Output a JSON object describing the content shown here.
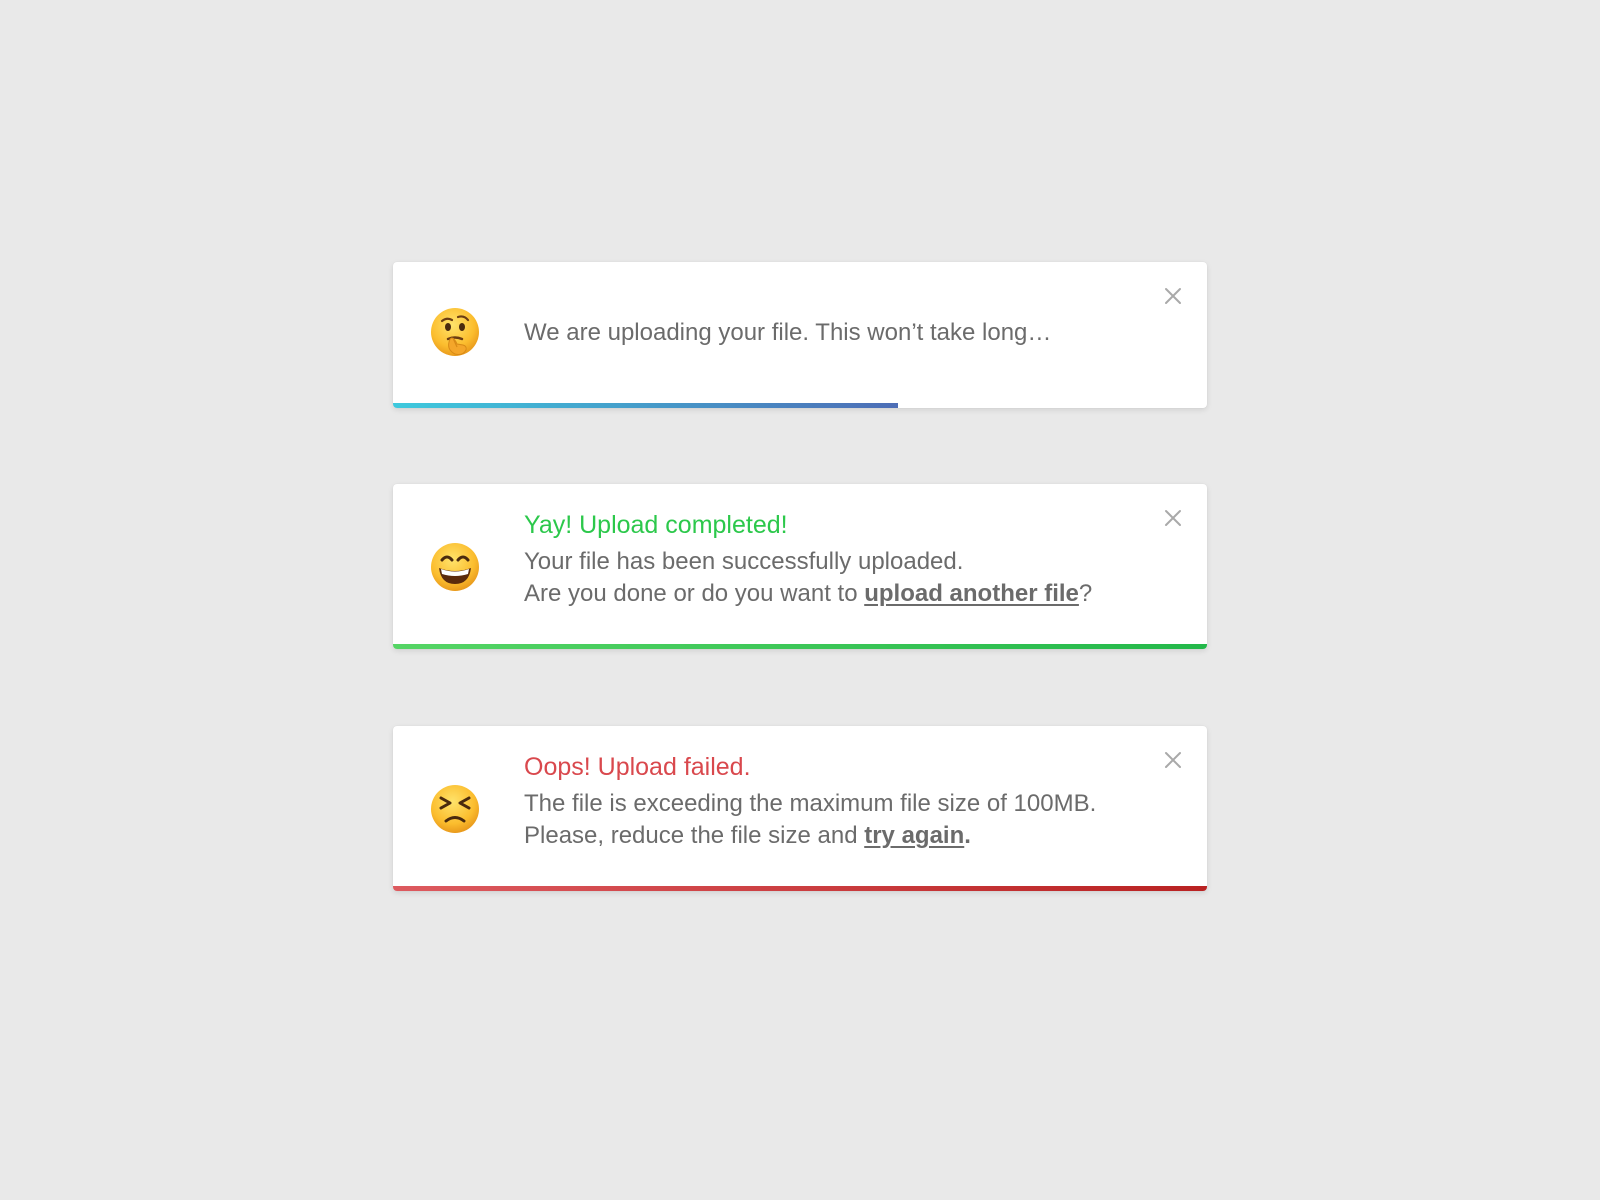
{
  "colors": {
    "background": "#e9e9e9",
    "text": "#6b6b6b",
    "success": "#2cc84b",
    "error": "#d9484d",
    "uploading_gradient": [
      "#3ec9dd",
      "#4d6db6"
    ],
    "success_gradient": [
      "#55d565",
      "#23b84a"
    ],
    "error_gradient": [
      "#dd5a5f",
      "#b92222"
    ]
  },
  "toasts": [
    {
      "id": "uploading",
      "icon": "thinking-face-emoji",
      "message": "We are uploading your file. This won’t take long…",
      "progress": 0.62,
      "close_icon": "close-icon"
    },
    {
      "id": "success",
      "icon": "grinning-face-emoji",
      "title": "Yay! Upload completed!",
      "line1": "Your file has been successfully uploaded.",
      "line2_prefix": "Are you done or do you want to ",
      "line2_link": "upload another file",
      "line2_suffix": "?",
      "progress": 1.0,
      "close_icon": "close-icon"
    },
    {
      "id": "error",
      "icon": "persevering-face-emoji",
      "title": "Oops! Upload failed.",
      "line1": "The file is exceeding the maximum file size of 100MB.",
      "line2_prefix": "Please, reduce the file size and ",
      "line2_link": "try again",
      "line2_suffix": ".",
      "progress": 1.0,
      "close_icon": "close-icon"
    }
  ]
}
